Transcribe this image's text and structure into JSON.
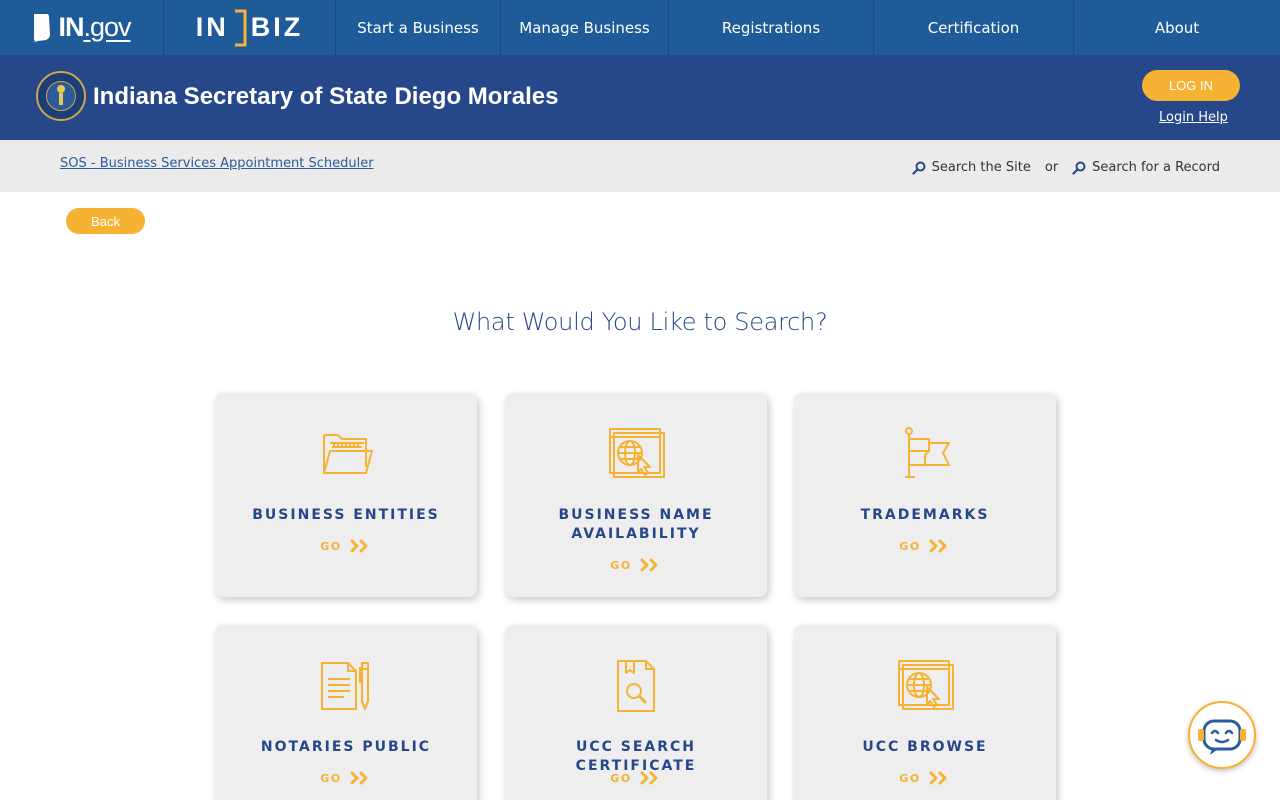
{
  "topnav": {
    "ingov_logo": {
      "main": "IN",
      "suffix": ".gov"
    },
    "inbiz_logo": {
      "left": "IN",
      "right": "BIZ"
    },
    "items": [
      {
        "label": "Start a Business"
      },
      {
        "label": "Manage Business"
      },
      {
        "label": "Registrations"
      },
      {
        "label": "Certification"
      },
      {
        "label": "About"
      }
    ]
  },
  "header": {
    "title": "Indiana Secretary of State Diego Morales",
    "login_label": "LOG IN",
    "login_help": "Login Help"
  },
  "subbar": {
    "breadcrumb": "SOS - Business Services Appointment Scheduler",
    "search_site": "Search the Site",
    "or": "or",
    "search_record": "Search for a Record"
  },
  "main": {
    "back_label": "Back",
    "heading": "What Would You Like to Search?",
    "cards": [
      {
        "label_line1": "BUSINESS ENTITIES",
        "label_line2": "",
        "go": "GO",
        "icon": "folder-icon"
      },
      {
        "label_line1": "BUSINESS NAME",
        "label_line2": "AVAILABILITY",
        "go": "GO",
        "icon": "globe-browser-icon"
      },
      {
        "label_line1": "TRADEMARKS",
        "label_line2": "",
        "go": "GO",
        "icon": "flag-icon"
      },
      {
        "label_line1": "NOTARIES PUBLIC",
        "label_line2": "",
        "go": "GO",
        "icon": "document-pen-icon"
      },
      {
        "label_line1": "UCC SEARCH CERTIFICATE",
        "label_line2": "",
        "go": "GO",
        "icon": "document-search-icon"
      },
      {
        "label_line1": "UCC BROWSE",
        "label_line2": "",
        "go": "GO",
        "icon": "globe-browser-icon"
      }
    ]
  },
  "colors": {
    "nav_bg": "#1f5b98",
    "header_bg": "#26488a",
    "accent": "#f5b233",
    "card_bg": "#eeeeee"
  }
}
